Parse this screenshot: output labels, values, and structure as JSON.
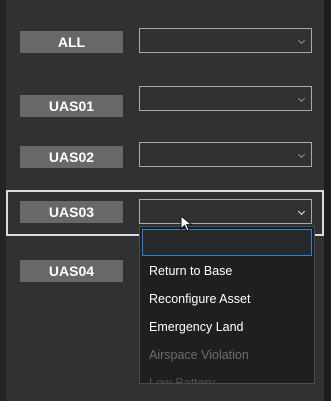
{
  "rows": [
    {
      "label": "ALL",
      "value": ""
    },
    {
      "label": "UAS01",
      "value": ""
    },
    {
      "label": "UAS02",
      "value": ""
    },
    {
      "label": "UAS03",
      "value": ""
    },
    {
      "label": "UAS04",
      "value": ""
    }
  ],
  "dropdown": {
    "selected": "",
    "options": [
      {
        "label": "Return to Base",
        "enabled": true
      },
      {
        "label": "Reconfigure Asset",
        "enabled": true
      },
      {
        "label": "Emergency Land",
        "enabled": true
      },
      {
        "label": "Airspace Violation",
        "enabled": false
      },
      {
        "label": "Low Battery",
        "enabled": false
      }
    ]
  },
  "icons": {
    "dropdown_arrow": "chevron-down-icon",
    "cursor": "mouse-pointer-icon"
  },
  "colors": {
    "label_bg": "#666869",
    "panel_bg": "#2f3133",
    "focus_border": "#2f83d6"
  }
}
